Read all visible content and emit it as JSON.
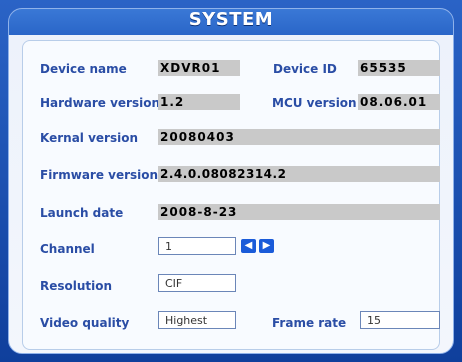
{
  "window": {
    "title": "SYSTEM"
  },
  "fields": {
    "device_name": {
      "label": "Device name",
      "value": "XDVR01"
    },
    "device_id": {
      "label": "Device ID",
      "value": "65535"
    },
    "hardware_version": {
      "label": "Hardware version",
      "value": "1.2"
    },
    "mcu_version": {
      "label": "MCU version",
      "value": "08.06.01"
    },
    "kernal_version": {
      "label": "Kernal version",
      "value": "20080403"
    },
    "firmware_version": {
      "label": "Firmware version",
      "value": "2.4.0.08082314.2"
    },
    "launch_date": {
      "label": "Launch date",
      "value": "2008-8-23"
    },
    "channel": {
      "label": "Channel",
      "value": "1"
    },
    "resolution": {
      "label": "Resolution",
      "value": "CIF"
    },
    "video_quality": {
      "label": "Video quality",
      "value": "Highest"
    },
    "frame_rate": {
      "label": "Frame rate",
      "value": "15"
    }
  },
  "icons": {
    "prev": "left-arrow-icon",
    "next": "right-arrow-icon"
  }
}
